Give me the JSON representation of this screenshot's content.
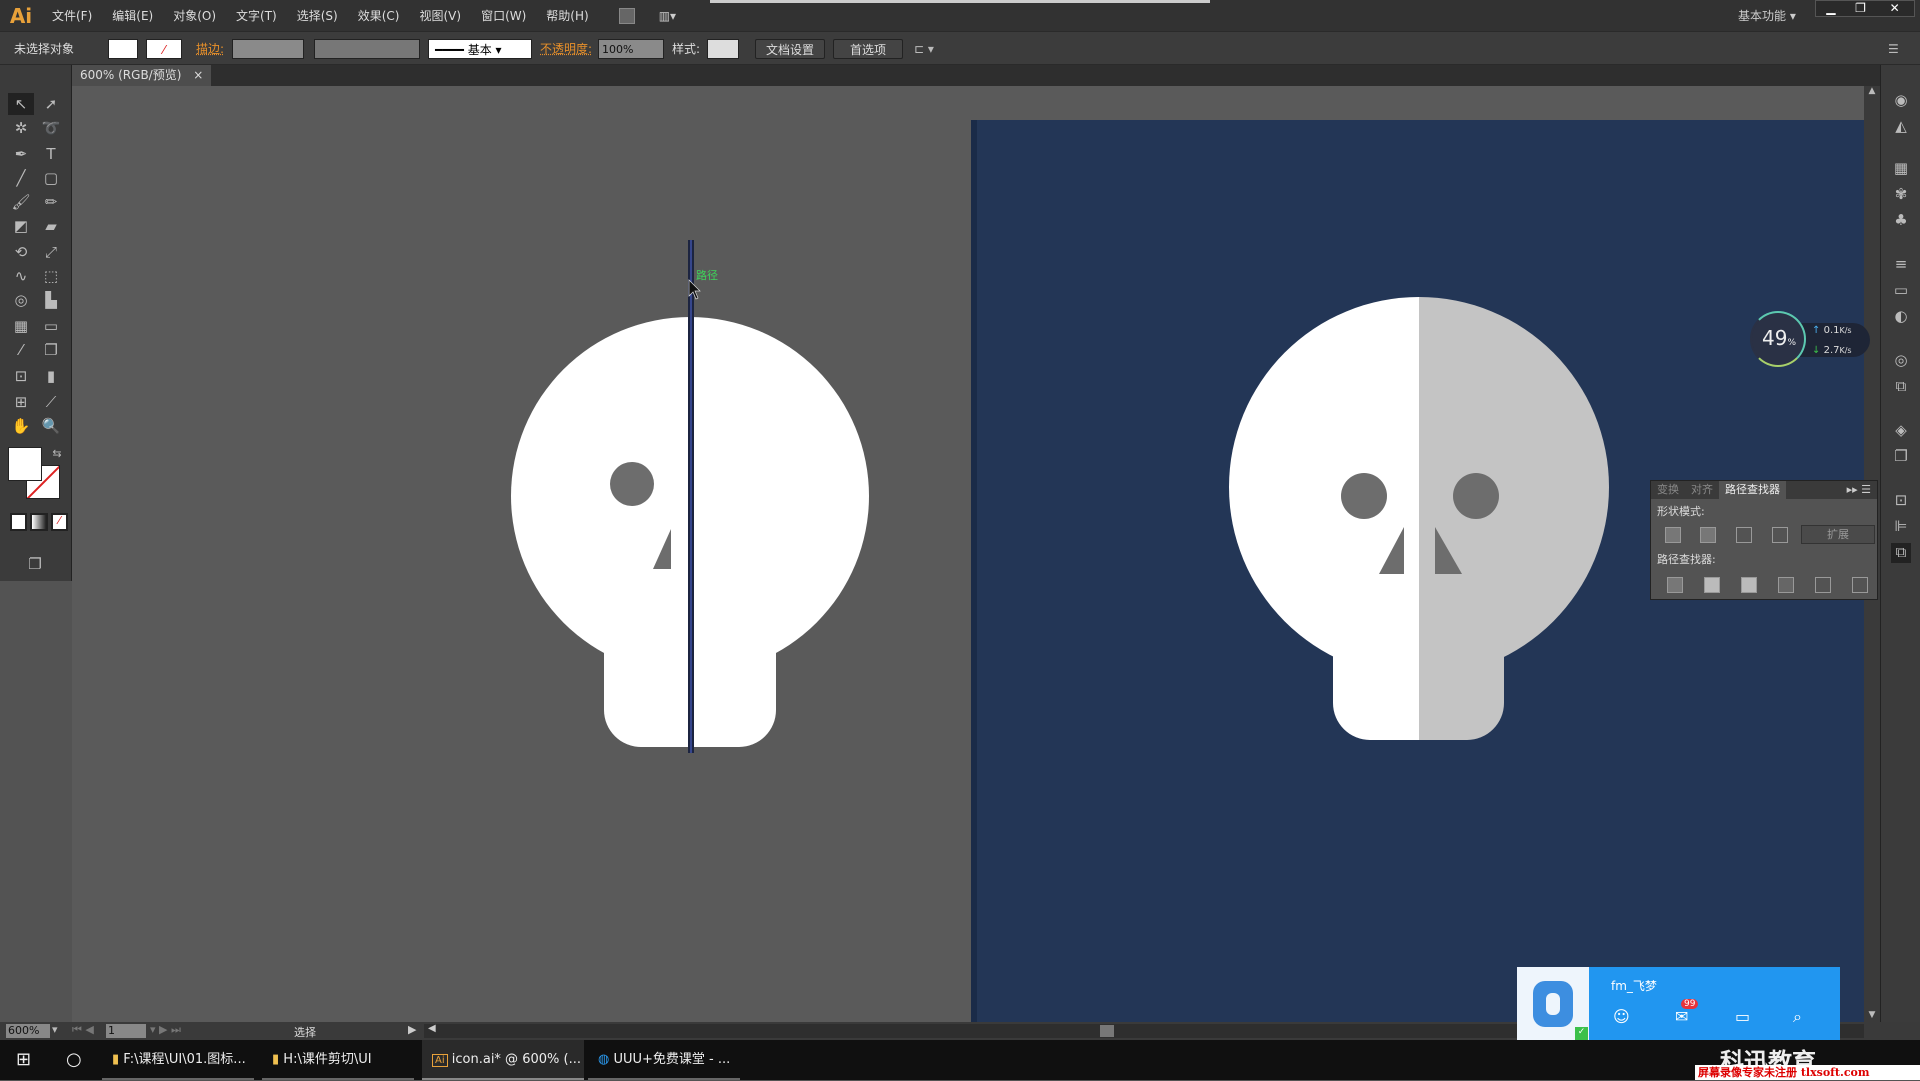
{
  "app": {
    "logo": "Ai",
    "workspace": "基本功能"
  },
  "menu": [
    "文件(F)",
    "编辑(E)",
    "对象(O)",
    "文字(T)",
    "选择(S)",
    "效果(C)",
    "视图(V)",
    "窗口(W)",
    "帮助(H)"
  ],
  "control": {
    "selection": "未选择对象",
    "stroke_label": "描边:",
    "stroke_style": "基本",
    "opacity_label": "不透明度:",
    "opacity": "100%",
    "style_label": "样式:",
    "doc_setup": "文档设置",
    "preferences": "首选项"
  },
  "document": {
    "tab": "600% (RGB/预览)",
    "path_hint": "路径"
  },
  "colors": {
    "artboard": "#233656",
    "canvas": "#5a5a5a",
    "skull_light": "#ffffff",
    "skull_shade": "#c4c4c4",
    "feature": "#6d6d6d",
    "guide": "#2b3a8a"
  },
  "pathfinder": {
    "tabs": [
      "变换",
      "对齐",
      "路径查找器"
    ],
    "shape_modes": "形状模式:",
    "expand": "扩展",
    "pathfinders": "路径查找器:"
  },
  "network": {
    "percent": "49",
    "percent_unit": "%",
    "up": "0.1",
    "down": "2.7",
    "unit": "K/s"
  },
  "status": {
    "zoom": "600%",
    "page": "1",
    "tool": "选择"
  },
  "taskbar": {
    "items": [
      "F:\\课程\\UI\\01.图标...",
      "H:\\课件剪切\\UI",
      "icon.ai* @ 600% (...",
      "UUU+免费课堂 - ..."
    ]
  },
  "qq": {
    "username": "fm_飞梦",
    "badge": "99"
  },
  "watermark": {
    "brand": "科迅教育",
    "notice": "屏幕录像专家未注册 tlxsoft.com"
  }
}
